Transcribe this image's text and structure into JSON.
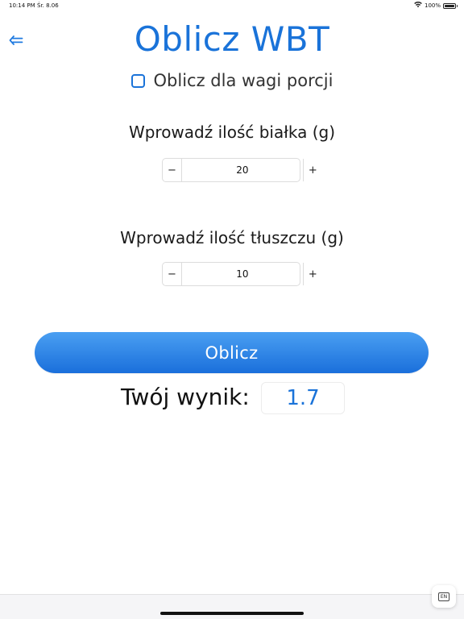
{
  "status_bar": {
    "time": "10:14 PM",
    "date": "Śr. 8.06",
    "battery_text": "100%",
    "battery_level": 1.0,
    "icons": [
      "wifi-icon",
      "battery-icon"
    ]
  },
  "header": {
    "back_icon": "arrow-left-icon",
    "title": "Oblicz WBT"
  },
  "portion_checkbox": {
    "label": "Oblicz dla wagi porcji",
    "checked": false
  },
  "protein": {
    "label": "Wprowadź ilość białka (g)",
    "minus_label": "−",
    "plus_label": "+",
    "value": "20"
  },
  "fat": {
    "label": "Wprowadź ilość tłuszczu (g)",
    "minus_label": "−",
    "plus_label": "+",
    "value": "10"
  },
  "calculate_button": {
    "label": "Oblicz"
  },
  "result": {
    "label": "Twój wynik:",
    "value": "1.7"
  },
  "keyboard_badge": {
    "label": "EN"
  },
  "colors": {
    "accent": "#1a73d9",
    "button_top": "#4a9ff2",
    "button_bottom": "#1a6fdb"
  }
}
